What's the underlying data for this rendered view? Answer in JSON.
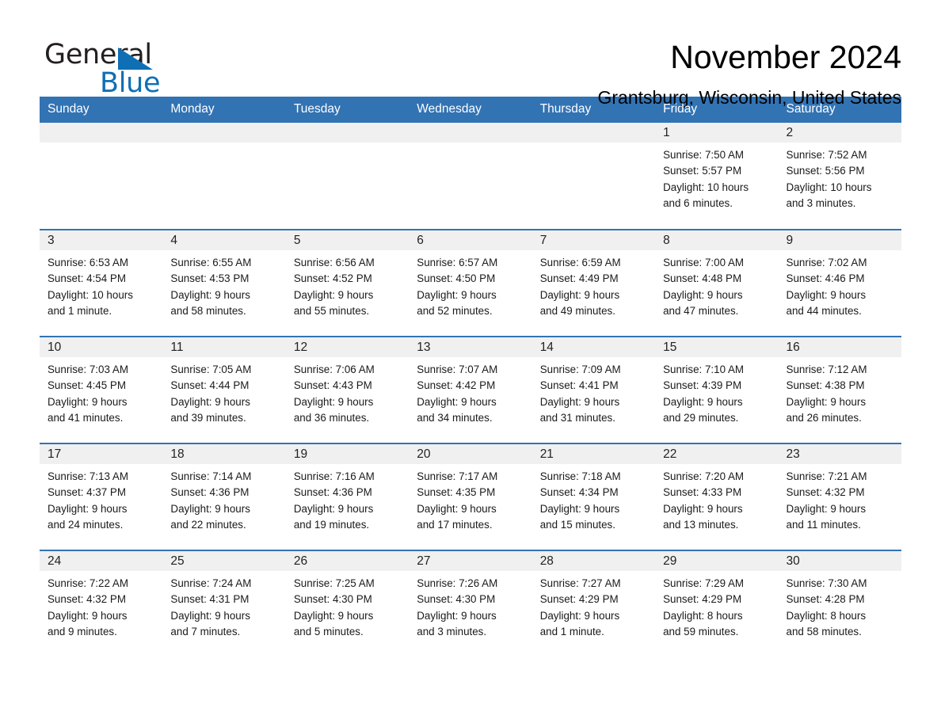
{
  "logo": {
    "word_general": "General",
    "word_blue": "Blue",
    "triangle_color": "#0f6fb5"
  },
  "header": {
    "title": "November 2024",
    "subtitle": "Grantsburg, Wisconsin, United States"
  },
  "theme": {
    "header_blue": "#3273b4",
    "daynum_gray": "#f0f0f0",
    "text_black": "#000000"
  },
  "labels": {
    "sunrise_prefix": "Sunrise:",
    "sunset_prefix": "Sunset:",
    "daylight_prefix": "Daylight:"
  },
  "weekday_headers": [
    "Sunday",
    "Monday",
    "Tuesday",
    "Wednesday",
    "Thursday",
    "Friday",
    "Saturday"
  ],
  "weeks": [
    [
      {
        "day": "",
        "sunrise": "",
        "sunset": "",
        "daylight_line1": "",
        "daylight_line2": ""
      },
      {
        "day": "",
        "sunrise": "",
        "sunset": "",
        "daylight_line1": "",
        "daylight_line2": ""
      },
      {
        "day": "",
        "sunrise": "",
        "sunset": "",
        "daylight_line1": "",
        "daylight_line2": ""
      },
      {
        "day": "",
        "sunrise": "",
        "sunset": "",
        "daylight_line1": "",
        "daylight_line2": ""
      },
      {
        "day": "",
        "sunrise": "",
        "sunset": "",
        "daylight_line1": "",
        "daylight_line2": ""
      },
      {
        "day": "1",
        "sunrise": "Sunrise: 7:50 AM",
        "sunset": "Sunset: 5:57 PM",
        "daylight_line1": "Daylight: 10 hours",
        "daylight_line2": "and 6 minutes."
      },
      {
        "day": "2",
        "sunrise": "Sunrise: 7:52 AM",
        "sunset": "Sunset: 5:56 PM",
        "daylight_line1": "Daylight: 10 hours",
        "daylight_line2": "and 3 minutes."
      }
    ],
    [
      {
        "day": "3",
        "sunrise": "Sunrise: 6:53 AM",
        "sunset": "Sunset: 4:54 PM",
        "daylight_line1": "Daylight: 10 hours",
        "daylight_line2": "and 1 minute."
      },
      {
        "day": "4",
        "sunrise": "Sunrise: 6:55 AM",
        "sunset": "Sunset: 4:53 PM",
        "daylight_line1": "Daylight: 9 hours",
        "daylight_line2": "and 58 minutes."
      },
      {
        "day": "5",
        "sunrise": "Sunrise: 6:56 AM",
        "sunset": "Sunset: 4:52 PM",
        "daylight_line1": "Daylight: 9 hours",
        "daylight_line2": "and 55 minutes."
      },
      {
        "day": "6",
        "sunrise": "Sunrise: 6:57 AM",
        "sunset": "Sunset: 4:50 PM",
        "daylight_line1": "Daylight: 9 hours",
        "daylight_line2": "and 52 minutes."
      },
      {
        "day": "7",
        "sunrise": "Sunrise: 6:59 AM",
        "sunset": "Sunset: 4:49 PM",
        "daylight_line1": "Daylight: 9 hours",
        "daylight_line2": "and 49 minutes."
      },
      {
        "day": "8",
        "sunrise": "Sunrise: 7:00 AM",
        "sunset": "Sunset: 4:48 PM",
        "daylight_line1": "Daylight: 9 hours",
        "daylight_line2": "and 47 minutes."
      },
      {
        "day": "9",
        "sunrise": "Sunrise: 7:02 AM",
        "sunset": "Sunset: 4:46 PM",
        "daylight_line1": "Daylight: 9 hours",
        "daylight_line2": "and 44 minutes."
      }
    ],
    [
      {
        "day": "10",
        "sunrise": "Sunrise: 7:03 AM",
        "sunset": "Sunset: 4:45 PM",
        "daylight_line1": "Daylight: 9 hours",
        "daylight_line2": "and 41 minutes."
      },
      {
        "day": "11",
        "sunrise": "Sunrise: 7:05 AM",
        "sunset": "Sunset: 4:44 PM",
        "daylight_line1": "Daylight: 9 hours",
        "daylight_line2": "and 39 minutes."
      },
      {
        "day": "12",
        "sunrise": "Sunrise: 7:06 AM",
        "sunset": "Sunset: 4:43 PM",
        "daylight_line1": "Daylight: 9 hours",
        "daylight_line2": "and 36 minutes."
      },
      {
        "day": "13",
        "sunrise": "Sunrise: 7:07 AM",
        "sunset": "Sunset: 4:42 PM",
        "daylight_line1": "Daylight: 9 hours",
        "daylight_line2": "and 34 minutes."
      },
      {
        "day": "14",
        "sunrise": "Sunrise: 7:09 AM",
        "sunset": "Sunset: 4:41 PM",
        "daylight_line1": "Daylight: 9 hours",
        "daylight_line2": "and 31 minutes."
      },
      {
        "day": "15",
        "sunrise": "Sunrise: 7:10 AM",
        "sunset": "Sunset: 4:39 PM",
        "daylight_line1": "Daylight: 9 hours",
        "daylight_line2": "and 29 minutes."
      },
      {
        "day": "16",
        "sunrise": "Sunrise: 7:12 AM",
        "sunset": "Sunset: 4:38 PM",
        "daylight_line1": "Daylight: 9 hours",
        "daylight_line2": "and 26 minutes."
      }
    ],
    [
      {
        "day": "17",
        "sunrise": "Sunrise: 7:13 AM",
        "sunset": "Sunset: 4:37 PM",
        "daylight_line1": "Daylight: 9 hours",
        "daylight_line2": "and 24 minutes."
      },
      {
        "day": "18",
        "sunrise": "Sunrise: 7:14 AM",
        "sunset": "Sunset: 4:36 PM",
        "daylight_line1": "Daylight: 9 hours",
        "daylight_line2": "and 22 minutes."
      },
      {
        "day": "19",
        "sunrise": "Sunrise: 7:16 AM",
        "sunset": "Sunset: 4:36 PM",
        "daylight_line1": "Daylight: 9 hours",
        "daylight_line2": "and 19 minutes."
      },
      {
        "day": "20",
        "sunrise": "Sunrise: 7:17 AM",
        "sunset": "Sunset: 4:35 PM",
        "daylight_line1": "Daylight: 9 hours",
        "daylight_line2": "and 17 minutes."
      },
      {
        "day": "21",
        "sunrise": "Sunrise: 7:18 AM",
        "sunset": "Sunset: 4:34 PM",
        "daylight_line1": "Daylight: 9 hours",
        "daylight_line2": "and 15 minutes."
      },
      {
        "day": "22",
        "sunrise": "Sunrise: 7:20 AM",
        "sunset": "Sunset: 4:33 PM",
        "daylight_line1": "Daylight: 9 hours",
        "daylight_line2": "and 13 minutes."
      },
      {
        "day": "23",
        "sunrise": "Sunrise: 7:21 AM",
        "sunset": "Sunset: 4:32 PM",
        "daylight_line1": "Daylight: 9 hours",
        "daylight_line2": "and 11 minutes."
      }
    ],
    [
      {
        "day": "24",
        "sunrise": "Sunrise: 7:22 AM",
        "sunset": "Sunset: 4:32 PM",
        "daylight_line1": "Daylight: 9 hours",
        "daylight_line2": "and 9 minutes."
      },
      {
        "day": "25",
        "sunrise": "Sunrise: 7:24 AM",
        "sunset": "Sunset: 4:31 PM",
        "daylight_line1": "Daylight: 9 hours",
        "daylight_line2": "and 7 minutes."
      },
      {
        "day": "26",
        "sunrise": "Sunrise: 7:25 AM",
        "sunset": "Sunset: 4:30 PM",
        "daylight_line1": "Daylight: 9 hours",
        "daylight_line2": "and 5 minutes."
      },
      {
        "day": "27",
        "sunrise": "Sunrise: 7:26 AM",
        "sunset": "Sunset: 4:30 PM",
        "daylight_line1": "Daylight: 9 hours",
        "daylight_line2": "and 3 minutes."
      },
      {
        "day": "28",
        "sunrise": "Sunrise: 7:27 AM",
        "sunset": "Sunset: 4:29 PM",
        "daylight_line1": "Daylight: 9 hours",
        "daylight_line2": "and 1 minute."
      },
      {
        "day": "29",
        "sunrise": "Sunrise: 7:29 AM",
        "sunset": "Sunset: 4:29 PM",
        "daylight_line1": "Daylight: 8 hours",
        "daylight_line2": "and 59 minutes."
      },
      {
        "day": "30",
        "sunrise": "Sunrise: 7:30 AM",
        "sunset": "Sunset: 4:28 PM",
        "daylight_line1": "Daylight: 8 hours",
        "daylight_line2": "and 58 minutes."
      }
    ]
  ]
}
